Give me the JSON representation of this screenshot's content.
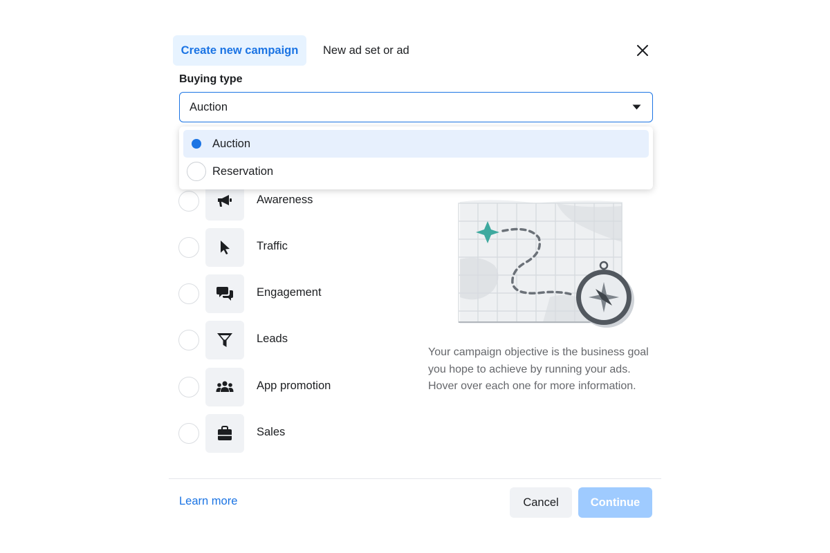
{
  "header": {
    "tabs": [
      {
        "label": "Create new campaign",
        "active": true
      },
      {
        "label": "New ad set or ad",
        "active": false
      }
    ]
  },
  "buying_type": {
    "label": "Buying type",
    "selected_value": "Auction",
    "options": [
      {
        "label": "Auction",
        "selected": true
      },
      {
        "label": "Reservation",
        "selected": false
      }
    ]
  },
  "objectives": [
    {
      "label": "Awareness",
      "icon": "megaphone-icon"
    },
    {
      "label": "Traffic",
      "icon": "cursor-icon"
    },
    {
      "label": "Engagement",
      "icon": "chat-bubbles-icon"
    },
    {
      "label": "Leads",
      "icon": "funnel-icon"
    },
    {
      "label": "App promotion",
      "icon": "people-icon"
    },
    {
      "label": "Sales",
      "icon": "shopping-bag-icon"
    }
  ],
  "description": "Your campaign objective is the business goal you hope to achieve by running your ads. Hover over each one for more information.",
  "footer": {
    "learn_more": "Learn more",
    "cancel": "Cancel",
    "continue": "Continue"
  },
  "colors": {
    "accent": "#1b74e4",
    "accent_light": "#e7f3ff",
    "disabled_button": "#9fcbff",
    "teal_marker": "#3ea99f"
  }
}
